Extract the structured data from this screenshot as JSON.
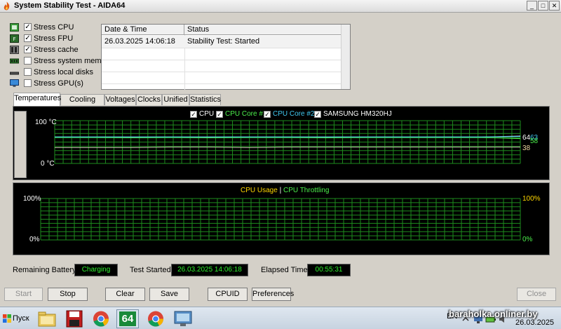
{
  "window": {
    "title": "System Stability Test - AIDA64",
    "min_glyph": "_",
    "max_glyph": "□",
    "close_glyph": "✕"
  },
  "options": [
    {
      "label": "Stress CPU",
      "checked": true,
      "icon": "cpu-icon"
    },
    {
      "label": "Stress FPU",
      "checked": true,
      "icon": "fpu-icon"
    },
    {
      "label": "Stress cache",
      "checked": true,
      "icon": "cache-icon"
    },
    {
      "label": "Stress system memory",
      "checked": false,
      "icon": "memory-icon"
    },
    {
      "label": "Stress local disks",
      "checked": false,
      "icon": "disk-icon"
    },
    {
      "label": "Stress GPU(s)",
      "checked": false,
      "icon": "monitor-icon"
    }
  ],
  "log": {
    "col_datetime": "Date & Time",
    "col_status": "Status",
    "rows": [
      {
        "datetime": "26.03.2025 14:06:18",
        "status": "Stability Test: Started"
      }
    ]
  },
  "tabs": [
    "Temperatures",
    "Cooling Fans",
    "Voltages",
    "Clocks",
    "Unified",
    "Statistics"
  ],
  "temp_chart": {
    "legend": [
      {
        "name": "CPU",
        "color": "#ffffff"
      },
      {
        "name": "CPU Core #1",
        "color": "#4cf04c"
      },
      {
        "name": "CPU Core #2",
        "color": "#40c8f0"
      },
      {
        "name": "SAMSUNG HM320HJ",
        "color": "#ffffff"
      }
    ],
    "y_max_label": "100 °C",
    "y_min_label": "0 °C",
    "readouts": [
      {
        "value": "64",
        "color": "#ffffff"
      },
      {
        "value": "63",
        "color": "#40c8f0"
      },
      {
        "value": "58",
        "color": "#4cf04c"
      },
      {
        "value": "38",
        "color": "#f0d8a0"
      }
    ]
  },
  "usage_chart": {
    "title_usage": "CPU Usage",
    "separator": "|",
    "title_throttling": "CPU Throttling",
    "y_max_left": "100%",
    "y_min_left": "0%",
    "y_max_right": "100%",
    "y_min_right": "0%"
  },
  "chart_data": [
    {
      "type": "line",
      "title": "",
      "series": [
        {
          "name": "CPU",
          "values": [
            62,
            62,
            62,
            62,
            62,
            62,
            62,
            62,
            62,
            62,
            62,
            62,
            64
          ]
        },
        {
          "name": "CPU Core #1",
          "values": [
            61,
            61,
            60,
            61,
            60,
            61,
            61,
            60,
            61,
            61,
            61,
            61,
            58
          ]
        },
        {
          "name": "CPU Core #2",
          "values": [
            62,
            62,
            62,
            62,
            62,
            62,
            62,
            62,
            62,
            62,
            62,
            62,
            63
          ]
        },
        {
          "name": "SAMSUNG HM320HJ",
          "values": [
            37,
            37,
            37,
            38,
            38,
            37,
            38,
            38,
            38,
            38,
            38,
            38,
            38
          ]
        }
      ],
      "ylim": [
        0,
        100
      ],
      "grid": true,
      "legend": "top-center"
    },
    {
      "type": "line",
      "title": "",
      "series": [
        {
          "name": "CPU Usage",
          "values": []
        },
        {
          "name": "CPU Throttling",
          "values": []
        }
      ],
      "ylim": [
        0,
        100
      ],
      "grid": true,
      "legend": "top-center"
    }
  ],
  "status": {
    "battery_label": "Remaining Battery:",
    "battery_value": "Charging",
    "started_label": "Test Started:",
    "started_value": "26.03.2025 14:06:18",
    "elapsed_label": "Elapsed Time:",
    "elapsed_value": "00:55:31"
  },
  "buttons": {
    "start": "Start",
    "stop": "Stop",
    "clear": "Clear",
    "save": "Save",
    "cpuid": "CPUID",
    "preferences": "Preferences",
    "close": "Close"
  },
  "taskbar": {
    "start_label": "Пуск",
    "aida_label": "64",
    "tray_lang": "EN",
    "tray_date": "26.03.2025",
    "watermark": "baraholka.onliner.by"
  },
  "colors": {
    "grid": "#1e8c1e",
    "graph_bg": "#000000",
    "status_text": "#2ef22e",
    "usage_title": "#ffd700",
    "throttle_title": "#4cf04c"
  }
}
